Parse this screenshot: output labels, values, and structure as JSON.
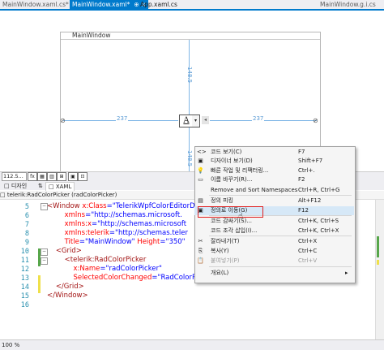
{
  "tabs": [
    {
      "label": "MainWindow.xaml.cs*",
      "close": ""
    },
    {
      "label": "MainWindow.xaml*",
      "close": "⊕ ×"
    },
    {
      "label": "App.xaml.cs",
      "close": ""
    },
    {
      "label": "MainWindow.g.i.cs",
      "close": ""
    }
  ],
  "designer": {
    "window_title": "MainWindow",
    "dim_top": "148.5",
    "dim_bottom": "148.5",
    "dim_left": "237",
    "dim_right": "237",
    "picker_letter": "A",
    "picker_arrow": "▾",
    "picker_extra": "◂"
  },
  "design_toolbar": {
    "zoom": "112.5..."
  },
  "view_tabs": {
    "design": "□ 디자인",
    "swap": "⇅",
    "xaml": "□ XAML"
  },
  "breadcrumb": "□ telerik:RadColorPicker (radColorPicker)",
  "line_numbers": [
    "5",
    "6",
    "7",
    "8",
    "9",
    "10",
    "11",
    "12",
    "13",
    "14",
    "15",
    "16"
  ],
  "code": [
    {
      "indent": "",
      "parts": [
        [
          "t",
          "<Window "
        ],
        [
          "r",
          "x:Class"
        ],
        [
          "b",
          "=\"TelerikWpfColorEditorDe"
        ]
      ]
    },
    {
      "indent": "        ",
      "parts": [
        [
          "r",
          "xmlns"
        ],
        [
          "b",
          "=\"http://schemas.microsoft."
        ]
      ]
    },
    {
      "indent": "        ",
      "parts": [
        [
          "r",
          "xmlns:x"
        ],
        [
          "b",
          "=\"http://schemas.microsoft"
        ]
      ]
    },
    {
      "indent": "        ",
      "parts": [
        [
          "r",
          "xmlns:telerik"
        ],
        [
          "b",
          "=\"http://schemas.teler"
        ]
      ]
    },
    {
      "indent": "        ",
      "parts": [
        [
          "r",
          "Title"
        ],
        [
          "b",
          "=\"MainWindow\" "
        ],
        [
          "r",
          "Height"
        ],
        [
          "b",
          "=\"350\""
        ]
      ]
    },
    {
      "indent": "    ",
      "parts": [
        [
          "t",
          "<Grid>"
        ]
      ]
    },
    {
      "indent": "        ",
      "parts": [
        [
          "t",
          "<telerik:RadColorPicker"
        ]
      ]
    },
    {
      "indent": "            ",
      "parts": [
        [
          "r",
          "x:Name"
        ],
        [
          "b",
          "=\"radColorPicker\""
        ]
      ]
    },
    {
      "indent": "            ",
      "parts": [
        [
          "r",
          "SelectedColorChanged"
        ],
        [
          "b",
          "=\"RadColorPicker_SelectedColorChanged\""
        ],
        [
          "t",
          "/>"
        ]
      ]
    },
    {
      "indent": "    ",
      "parts": [
        [
          "t",
          "</Grid>"
        ]
      ]
    },
    {
      "indent": "",
      "parts": [
        [
          "t",
          "</Window>"
        ]
      ]
    },
    {
      "indent": "",
      "parts": []
    }
  ],
  "status": "100 %",
  "menu": [
    {
      "icon": "<>",
      "label": "코드 보기(C)",
      "shortcut": "F7",
      "disabled": false
    },
    {
      "icon": "▣",
      "label": "디자이너 보기(D)",
      "shortcut": "Shift+F7",
      "disabled": false
    },
    {
      "icon": "💡",
      "label": "빠른 작업 및 리팩터링...",
      "shortcut": "Ctrl+.",
      "disabled": false
    },
    {
      "icon": "▭",
      "label": "이름 바꾸기(R)...",
      "shortcut": "F2",
      "disabled": false
    },
    {
      "icon": "",
      "label": "Remove and Sort Namespaces",
      "shortcut": "Ctrl+R, Ctrl+G",
      "disabled": false
    },
    {
      "icon": "▤",
      "label": "정의 피킹",
      "shortcut": "Alt+F12",
      "disabled": false
    },
    {
      "icon": "▣",
      "label": "정의로 이동(G)",
      "shortcut": "F12",
      "disabled": false
    },
    {
      "icon": "",
      "label": "코드 감싸기(S)...",
      "shortcut": "Ctrl+K, Ctrl+S",
      "disabled": false
    },
    {
      "icon": "",
      "label": "코드 조각 삽입(I)...",
      "shortcut": "Ctrl+K, Ctrl+X",
      "disabled": false
    },
    {
      "icon": "✂",
      "label": "잘라내기(T)",
      "shortcut": "Ctrl+X",
      "disabled": false
    },
    {
      "icon": "⎘",
      "label": "복사(Y)",
      "shortcut": "Ctrl+C",
      "disabled": false
    },
    {
      "icon": "📋",
      "label": "붙여넣기(P)",
      "shortcut": "Ctrl+V",
      "disabled": true
    },
    {
      "icon": "",
      "label": "개요(L)",
      "shortcut": "",
      "disabled": false
    }
  ]
}
